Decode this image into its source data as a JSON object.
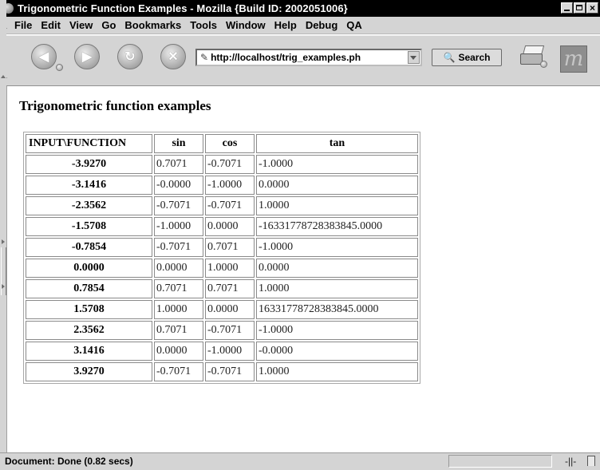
{
  "window": {
    "title": "Trigonometric Function Examples - Mozilla {Build ID: 2002051006}",
    "close_glyph": "×"
  },
  "menu": {
    "items": [
      {
        "label": "File"
      },
      {
        "label": "Edit"
      },
      {
        "label": "View"
      },
      {
        "label": "Go"
      },
      {
        "label": "Bookmarks"
      },
      {
        "label": "Tools"
      },
      {
        "label": "Window"
      },
      {
        "label": "Help"
      },
      {
        "label": "Debug"
      },
      {
        "label": "QA"
      }
    ]
  },
  "toolbar": {
    "back_glyph": "◀",
    "forward_glyph": "▶",
    "reload_glyph": "↻",
    "stop_glyph": "✕",
    "url": "http://localhost/trig_examples.ph",
    "page_icon": "✎",
    "search_label": "Search",
    "search_glyph": "🔍",
    "throbber_glyph": "m"
  },
  "page": {
    "heading": "Trigonometric function examples",
    "table": {
      "headers": [
        "INPUT\\FUNCTION",
        "sin",
        "cos",
        "tan"
      ],
      "rows": [
        {
          "input": "-3.9270",
          "sin": "0.7071",
          "cos": "-0.7071",
          "tan": "-1.0000"
        },
        {
          "input": "-3.1416",
          "sin": "-0.0000",
          "cos": "-1.0000",
          "tan": "0.0000"
        },
        {
          "input": "-2.3562",
          "sin": "-0.7071",
          "cos": "-0.7071",
          "tan": "1.0000"
        },
        {
          "input": "-1.5708",
          "sin": "-1.0000",
          "cos": "0.0000",
          "tan": "-16331778728383845.0000"
        },
        {
          "input": "-0.7854",
          "sin": "-0.7071",
          "cos": "0.7071",
          "tan": "-1.0000"
        },
        {
          "input": "0.0000",
          "sin": "0.0000",
          "cos": "1.0000",
          "tan": "0.0000"
        },
        {
          "input": "0.7854",
          "sin": "0.7071",
          "cos": "0.7071",
          "tan": "1.0000"
        },
        {
          "input": "1.5708",
          "sin": "1.0000",
          "cos": "0.0000",
          "tan": "16331778728383845.0000"
        },
        {
          "input": "2.3562",
          "sin": "0.7071",
          "cos": "-0.7071",
          "tan": "-1.0000"
        },
        {
          "input": "3.1416",
          "sin": "0.0000",
          "cos": "-1.0000",
          "tan": "-0.0000"
        },
        {
          "input": "3.9270",
          "sin": "-0.7071",
          "cos": "-0.7071",
          "tan": "1.0000"
        }
      ]
    }
  },
  "status": {
    "text": "Document: Done (0.82 secs)",
    "online_glyph": "-||-"
  }
}
